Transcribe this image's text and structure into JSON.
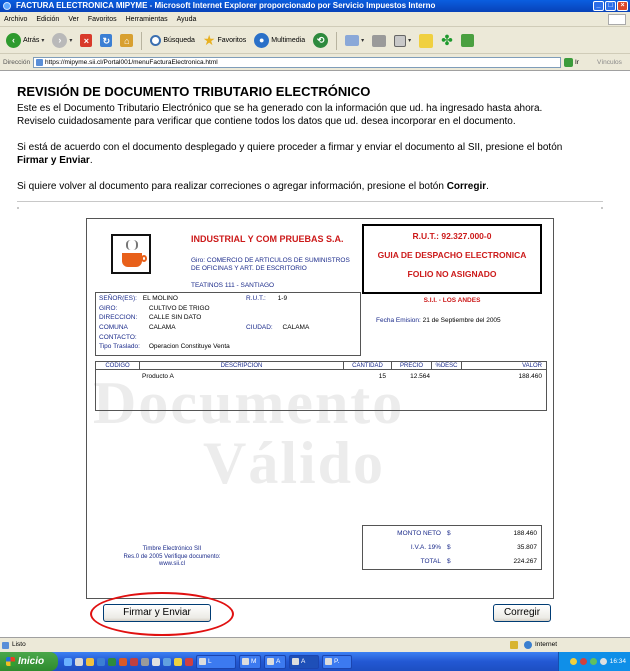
{
  "window": {
    "title": "FACTURA ELECTRONICA MIPYME - Microsoft Internet Explorer proporcionado por Servicio Impuestos Interno"
  },
  "menu": [
    "Archivo",
    "Edición",
    "Ver",
    "Favoritos",
    "Herramientas",
    "Ayuda"
  ],
  "toolbar": {
    "back_label": "Atrás",
    "search_label": "Búsqueda",
    "favorites_label": "Favoritos",
    "media_label": "Multimedia"
  },
  "address": {
    "label": "Dirección",
    "url": "https://mipyme.sii.cl/Portal001/menuFacturaElectronica.html",
    "go_label": "Ir",
    "links_label": "Vínculos"
  },
  "page": {
    "heading": "REVISIÓN DE DOCUMENTO TRIBUTARIO ELECTRÓNICO",
    "p1_line1": "Este es el Documento Tributario Electrónico que se ha generado con la información que ud. ha ingresado hasta ahora.",
    "p1_line2": "Reviselo cuidadosamente para verificar que contiene todos los datos que ud. desea incorporar en el documento.",
    "p2_line1": "Si está de acuerdo con el documento desplegado y quiere proceder a firmar y enviar el documento al SII, presione el botón",
    "p2_line2": "Firmar y Enviar",
    "p2_line2_end": ".",
    "p3_start": "Si quiere volver al documento para realizar correciones o agregar información, presione el botón ",
    "p3_bold": "Corregir",
    "p3_end": "."
  },
  "document": {
    "watermark1": "Documento",
    "watermark2": "Válido",
    "company_name": "INDUSTRIAL Y COM PRUEBAS S.A.",
    "giro": "Giro: COMERCIO DE ARTICULOS DE SUMINISTROS DE OFICINAS Y ART. DE ESCRITORIO",
    "address": "TEATINOS 111 - SANTIAGO",
    "rut": "R.U.T.: 92.327.000-0",
    "doc_type": "GUIA DE DESPACHO ELECTRONICA",
    "folio": "FOLIO NO ASIGNADO",
    "sii_office": "S.I.I. - LOS ANDES",
    "fecha_label": "Fecha Emision:",
    "fecha_value": "21 de Septiembre del 2005",
    "client": {
      "senores_label": "SEÑOR(ES):",
      "senores": "EL MOLINO",
      "rut_label": "R.U.T.:",
      "rut": "1-9",
      "giro_label": "GIRO:",
      "giro": "CULTIVO DE TRIGO",
      "direccion_label": "DIRECCION:",
      "direccion": "CALLE SIN DATO",
      "comuna_label": "COMUNA",
      "comuna": "CALAMA",
      "ciudad_label": "CIUDAD:",
      "ciudad": "CALAMA",
      "contacto_label": "CONTACTO:",
      "tipo_label": "Tipo Traslado:",
      "tipo": "Operacion Constituye Venta"
    },
    "columns": [
      "CODIGO",
      "DESCRIPCION",
      "CANTIDAD",
      "PRECIO",
      "%DESC",
      "VALOR"
    ],
    "items": [
      {
        "codigo": "",
        "descripcion": "Producto A",
        "cantidad": "15",
        "precio": "12.564",
        "desc": "",
        "valor": "188.460"
      }
    ],
    "timbre_line1": "Timbre Electrónico SII",
    "timbre_line2": "Res.0 de 2005 Verifique documento:",
    "timbre_line3": "www.sii.cl",
    "totals": [
      {
        "label": "MONTO NETO",
        "currency": "$",
        "value": "188.460"
      },
      {
        "label": "I.V.A. 19%",
        "currency": "$",
        "value": "35.807"
      },
      {
        "label": "TOTAL",
        "currency": "$",
        "value": "224.267"
      }
    ]
  },
  "buttons": {
    "sign": "Firmar y Enviar",
    "correct": "Corregir"
  },
  "status": {
    "left": "Listo",
    "zone": "Internet"
  },
  "taskbar": {
    "start": "Inicio",
    "tasks": [
      "L",
      "M",
      "A",
      "A",
      "P."
    ],
    "clock": "16:34"
  }
}
